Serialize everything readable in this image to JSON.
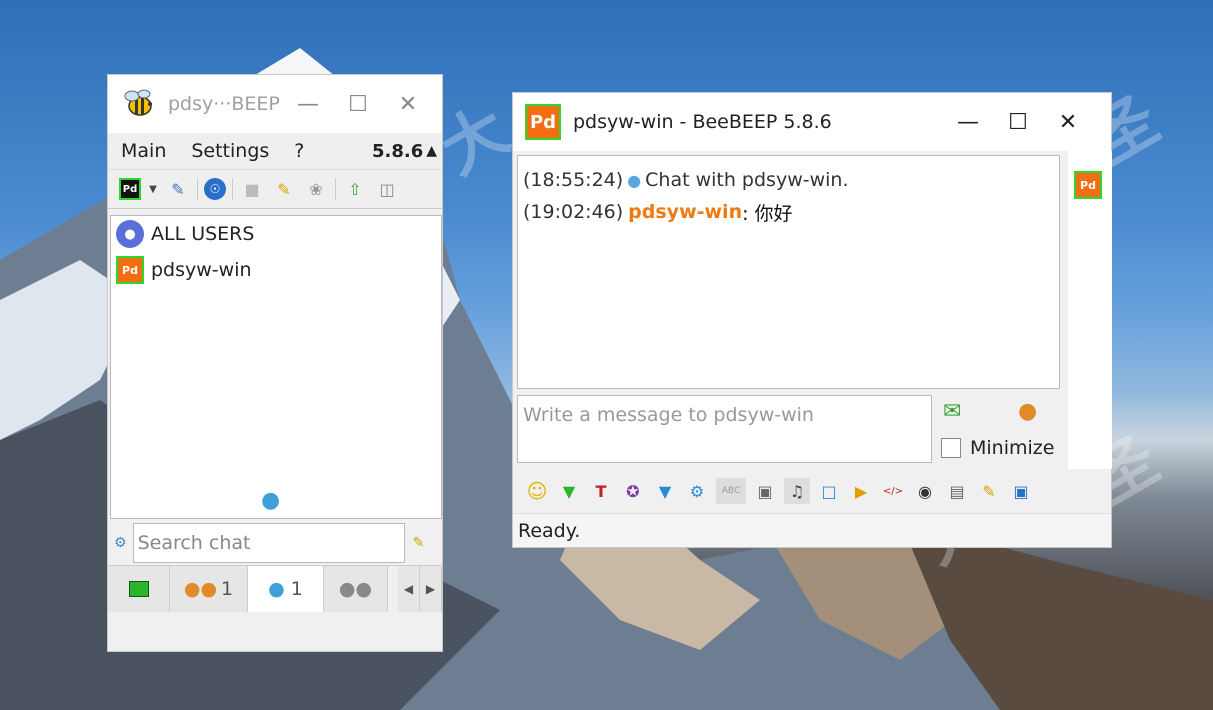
{
  "window_main": {
    "title": "pdsy···BEEP",
    "menu": [
      "Main",
      "Settings",
      "?"
    ],
    "version": "5.8.6",
    "users": [
      {
        "label": "ALL USERS",
        "icon": "group-chat-icon"
      },
      {
        "label": "pdsyw-win",
        "badge": "Pd"
      }
    ],
    "search": {
      "placeholder": "Search chat"
    },
    "tabs": [
      {
        "icon": "network-icon",
        "count": ""
      },
      {
        "icon": "users-icon",
        "count": "1"
      },
      {
        "icon": "chat-icon",
        "count": "1"
      },
      {
        "icon": "groups-icon",
        "count": ""
      }
    ]
  },
  "window_chat": {
    "badge": "Pd",
    "title": "pdsyw-win - BeeBEEP 5.8.6",
    "messages": [
      {
        "time": "(18:55:24)",
        "nick": "",
        "text": "Chat with pdsyw-win."
      },
      {
        "time": "(19:02:46)",
        "nick": "pdsyw-win",
        "text": ": 你好"
      }
    ],
    "input_placeholder": "Write a message to pdsyw-win",
    "minimize_label": "Minimize",
    "status": "Ready.",
    "side_badge": "Pd"
  },
  "watermark": [
    "大",
    "鹏",
    "圣"
  ],
  "colors": {
    "accent": "#f07a12",
    "badge_border": "#2bd82b",
    "badge_bg": "#f36d12"
  }
}
